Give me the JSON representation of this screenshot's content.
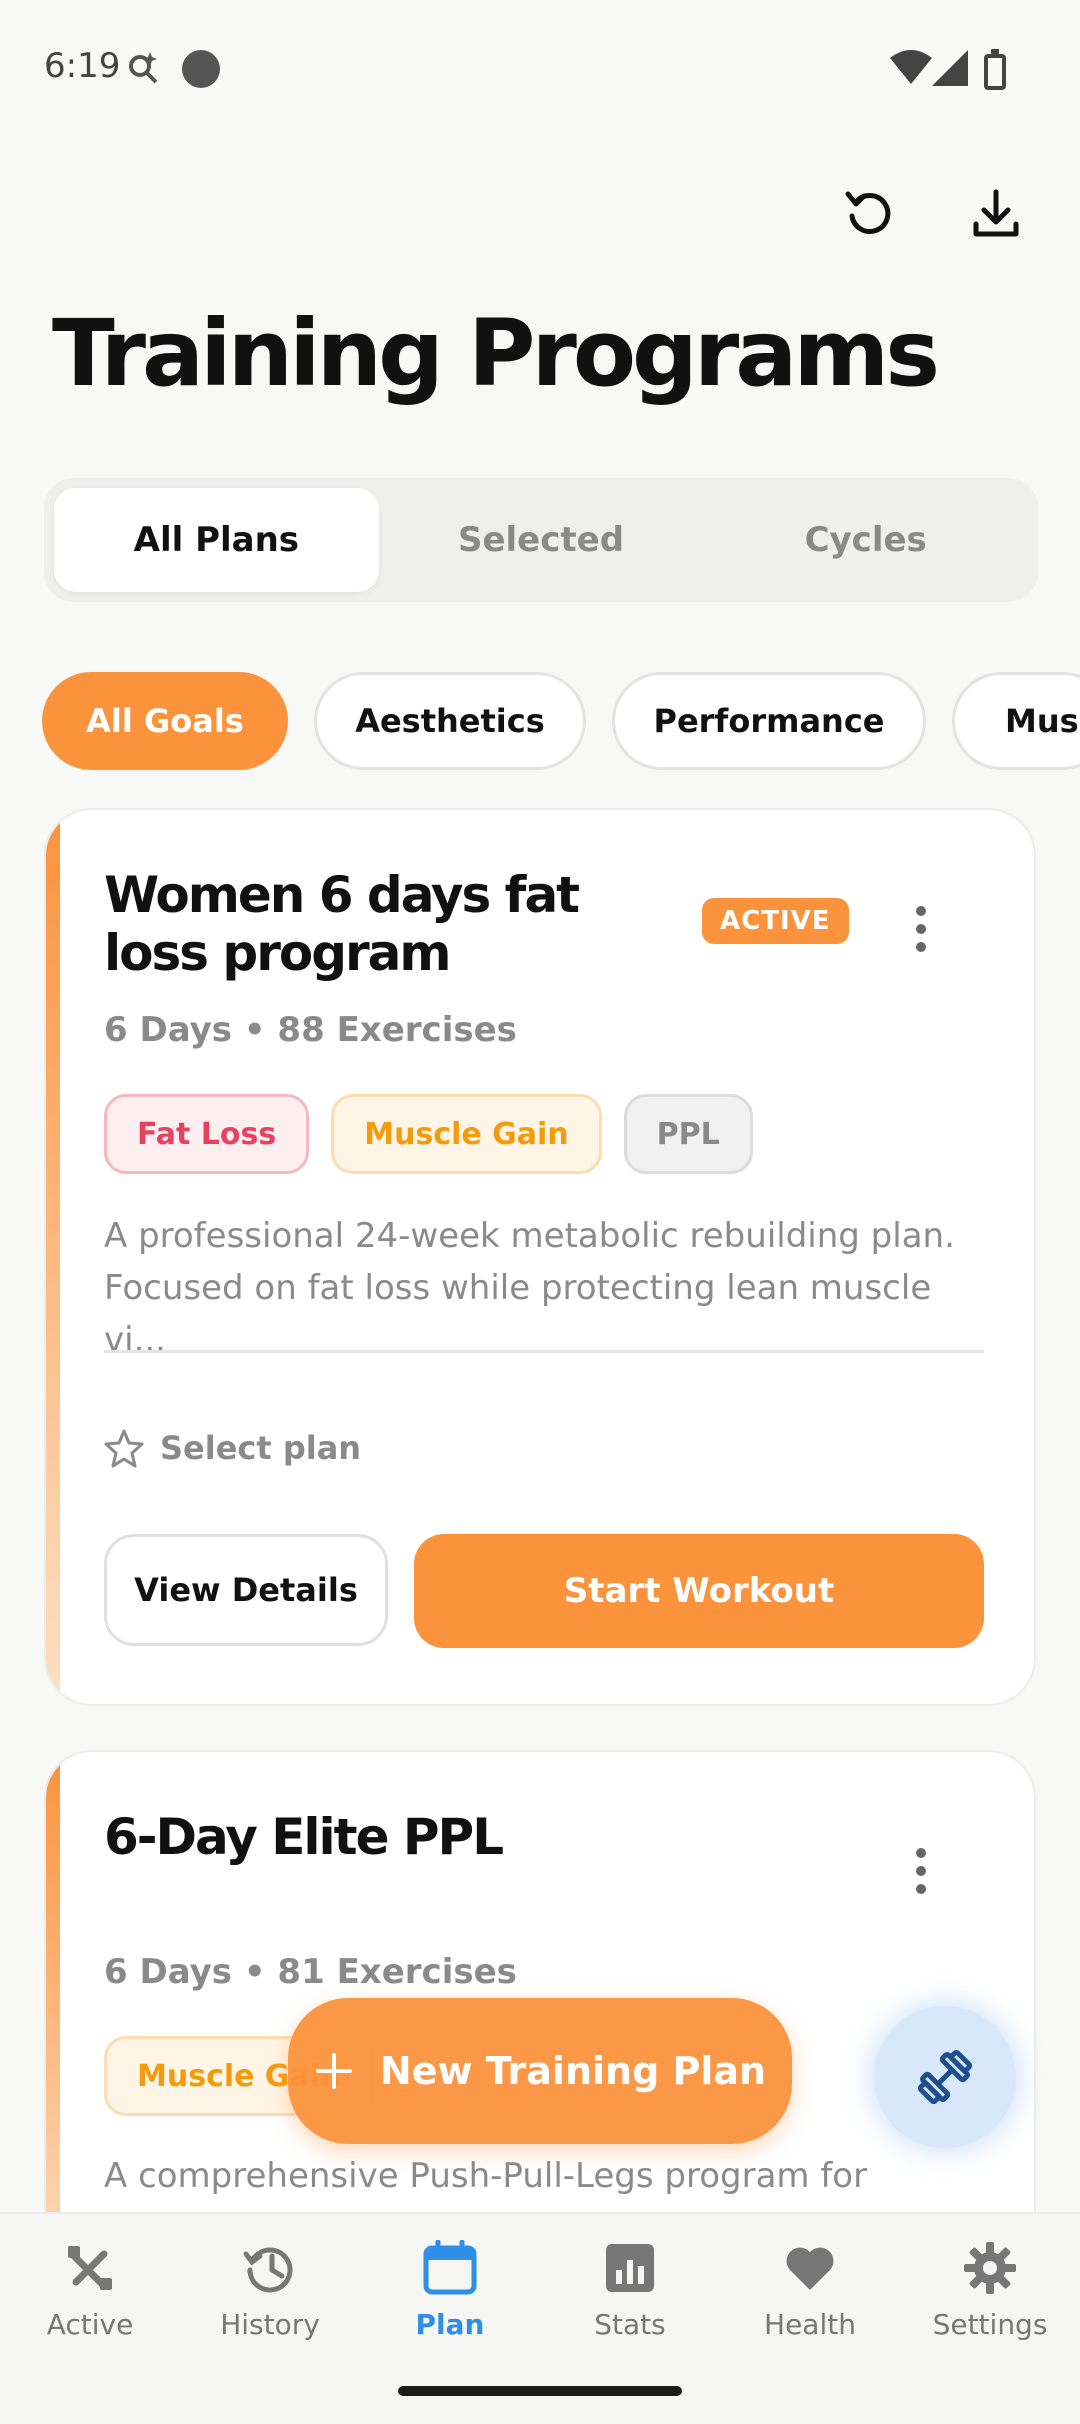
{
  "status_bar": {
    "time": "6:19"
  },
  "header": {
    "title": "Training Programs"
  },
  "tabs": [
    {
      "label": "All Plans",
      "active": true
    },
    {
      "label": "Selected",
      "active": false
    },
    {
      "label": "Cycles",
      "active": false
    }
  ],
  "goal_filters": [
    {
      "label": "All Goals",
      "active": true
    },
    {
      "label": "Aesthetics",
      "active": false
    },
    {
      "label": "Performance",
      "active": false
    },
    {
      "label": "Muscle",
      "active": false
    }
  ],
  "plans": [
    {
      "title": "Women 6 days fat loss program",
      "badge": "ACTIVE",
      "meta": "6 Days • 88 Exercises",
      "tags": [
        "Fat Loss",
        "Muscle Gain",
        "PPL"
      ],
      "description": "A professional 24-week metabolic rebuilding plan. Focused on fat loss while protecting lean muscle vi...",
      "select_label": "Select plan",
      "view_details_label": "View Details",
      "start_workout_label": "Start Workout"
    },
    {
      "title": "6-Day Elite PPL",
      "meta": "6 Days • 81 Exercises",
      "tags": [
        "Muscle Gain"
      ],
      "description": "A comprehensive Push-Pull-Legs program for"
    }
  ],
  "fab": {
    "new_plan_label": "New Training Plan"
  },
  "bottom_nav": [
    {
      "label": "Active",
      "icon": "tools-icon",
      "active": false
    },
    {
      "label": "History",
      "icon": "history-icon",
      "active": false
    },
    {
      "label": "Plan",
      "icon": "calendar-icon",
      "active": true
    },
    {
      "label": "Stats",
      "icon": "stats-icon",
      "active": false
    },
    {
      "label": "Health",
      "icon": "heart-icon",
      "active": false
    },
    {
      "label": "Settings",
      "icon": "gear-icon",
      "active": false
    }
  ],
  "colors": {
    "accent": "#fb923c",
    "nav_active": "#2f8ee8",
    "background": "#f8f8f6"
  }
}
